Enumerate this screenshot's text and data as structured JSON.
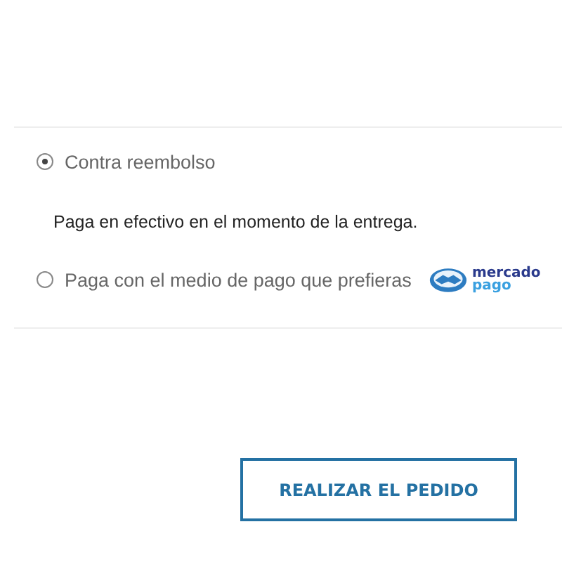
{
  "payment_options": [
    {
      "label": "Contra reembolso",
      "selected": true,
      "description": "Paga en efectivo en el momento de la entrega."
    },
    {
      "label": "Paga con el medio de pago que prefieras",
      "selected": false,
      "logo": {
        "line_1": "mercado",
        "line_2": "pago"
      }
    }
  ],
  "submit_button": {
    "label": "REALIZAR EL PEDIDO"
  }
}
